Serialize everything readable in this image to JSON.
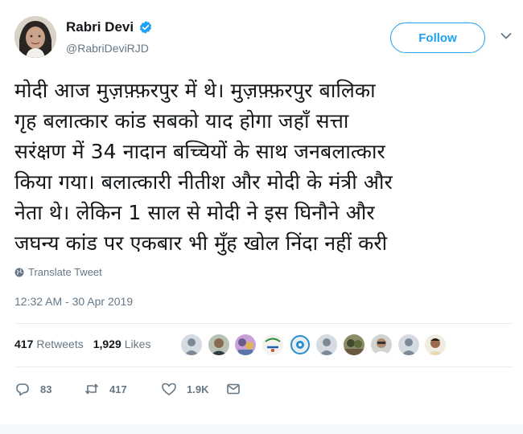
{
  "user": {
    "display_name": "Rabri Devi",
    "handle": "@RabriDeviRJD",
    "verified": true
  },
  "follow_button": {
    "label": "Follow"
  },
  "tweet": {
    "text": "मोदी आज मुज़फ़्फ़रपुर में थे। मुज़फ़्फ़रपुर बालिका\nगृह बलात्कार कांड सबको याद होगा जहाँ सत्ता\nसरंक्षण में 34 नादान बच्चियों के साथ जनबलात्कार\nकिया गया। बलात्कारी नीतीश और मोदी के मंत्री और\nनेता थे। लेकिन 1 साल से मोदी ने इस घिनौने और\nजघन्य कांड पर एकबार भी मुँह खोल निंदा नहीं करी",
    "translate_label": "Translate Tweet",
    "timestamp": "12:32 AM - 30 Apr 2019"
  },
  "stats": {
    "retweets_count": "417",
    "retweets_label": "Retweets",
    "likes_count": "1,929",
    "likes_label": "Likes"
  },
  "actions": {
    "reply_count": "83",
    "retweet_count": "417",
    "like_count": "1.9K"
  },
  "icons": {
    "verified": "verified-badge-icon",
    "caret": "chevron-down-icon",
    "globe": "globe-icon",
    "reply": "reply-icon",
    "retweet": "retweet-icon",
    "like": "heart-icon",
    "dm": "envelope-icon"
  },
  "colors": {
    "accent": "#1da1f2",
    "secondary_text": "#657786",
    "primary_text": "#14171a",
    "divider": "#e6ecf0"
  }
}
